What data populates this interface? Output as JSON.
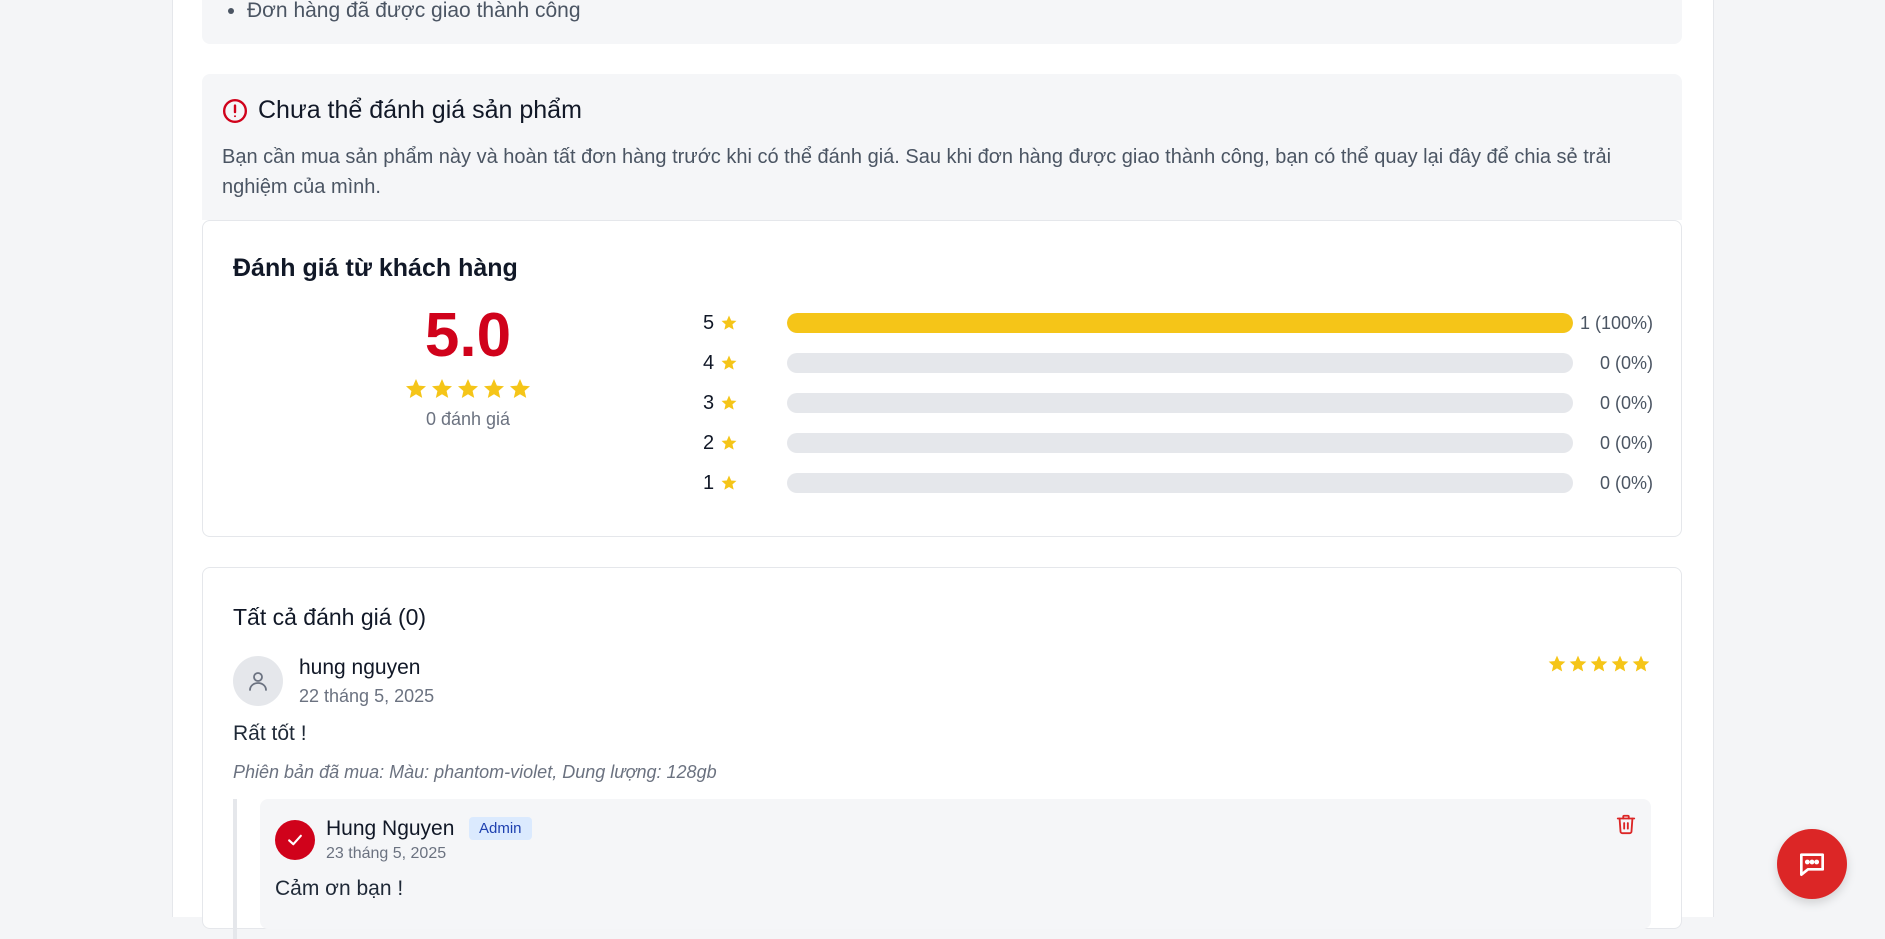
{
  "requirements": {
    "items": [
      "Đơn hàng đã được giao thành công"
    ]
  },
  "notice": {
    "title": "Chưa thể đánh giá sản phẩm",
    "text": "Bạn cần mua sản phẩm này và hoàn tất đơn hàng trước khi có thể đánh giá. Sau khi đơn hàng được giao thành công, bạn có thể quay lại đây để chia sẻ trải nghiệm của mình.",
    "icon": "alert-circle-icon",
    "color": "#d0021b"
  },
  "rating_summary": {
    "title": "Đánh giá từ khách hàng",
    "average": "5.0",
    "count_label": "0 đánh giá",
    "distribution": [
      {
        "stars": "5",
        "fraction": 1.0,
        "label": "1 (100%)"
      },
      {
        "stars": "4",
        "fraction": 0.0,
        "label": "0 (0%)"
      },
      {
        "stars": "3",
        "fraction": 0.0,
        "label": "0 (0%)"
      },
      {
        "stars": "2",
        "fraction": 0.0,
        "label": "0 (0%)"
      },
      {
        "stars": "1",
        "fraction": 0.0,
        "label": "0 (0%)"
      }
    ],
    "star_color": "#f5c518"
  },
  "reviews": {
    "title": "Tất cả đánh giá (0)",
    "items": [
      {
        "author": "hung nguyen",
        "date": "22 tháng 5, 2025",
        "rating": 5,
        "text": "Rất tốt !",
        "variant": "Phiên bản đã mua: Màu: phantom-violet, Dung lượng: 128gb",
        "reply": {
          "author": "Hung Nguyen",
          "badge": "Admin",
          "date": "23 tháng 5, 2025",
          "text": "Cảm ơn bạn !"
        }
      }
    ]
  },
  "chat_button": {
    "icon": "chat-message-icon",
    "color": "#dc2626"
  }
}
